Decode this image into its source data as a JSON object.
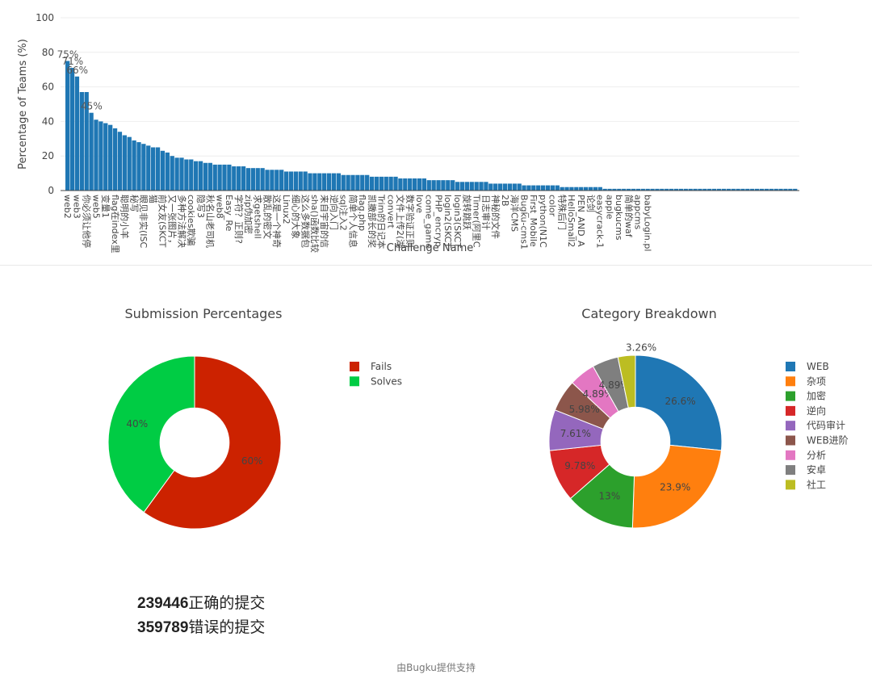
{
  "chart_data": [
    {
      "type": "bar",
      "title": "",
      "xlabel": "Challenge Name",
      "ylabel": "Percentage of Teams (%)",
      "ylim": [
        0,
        100
      ],
      "yticks": [
        0,
        20,
        40,
        60,
        80,
        100
      ],
      "grid": true,
      "bar_color": "#1f77b4",
      "categories": [
        "web2",
        "",
        "web3",
        "",
        "你必须让他停",
        "",
        "web5",
        "",
        "变量1",
        "",
        "flag在index里",
        "",
        "聪明的小羊",
        "",
        "秘写",
        "",
        "眼见非实(ISC",
        "",
        "猫",
        "",
        "前女友(SKCT",
        "",
        "又一张图片，",
        "",
        "多种方法解决",
        "",
        "cookies欺骗",
        "",
        "隐写3",
        "",
        "秋名山老司机",
        "",
        "web8",
        "",
        "Easy_Re",
        "",
        "字符？正则?",
        "",
        "zip伪加密",
        "",
        "求getshell",
        "",
        "散乱的密文",
        "",
        "这是一个神奇",
        "",
        "Linux2",
        "",
        "细心的大象",
        "",
        "这么多数据包",
        "",
        "sha()函数比较",
        "",
        "来自宇宙的信",
        "",
        "逆向入门",
        "",
        "sql注入2",
        "",
        "简单个人信息",
        "",
        "flag.php",
        "",
        "凯撒部长的奖",
        "",
        "Trim的日记本",
        "",
        "convert",
        "",
        "文件上传2(湖",
        "",
        "数字验证正则",
        "",
        "love",
        "",
        "come_game",
        "",
        "PHP_encryp",
        "",
        "login2(SKCT",
        "",
        "login3(SKCT",
        "",
        "旋转跳跃",
        "",
        "Timer(阿里C",
        "",
        "日志审计",
        "",
        "神秘的文件",
        "",
        "2B",
        "",
        "海洋CMS",
        "",
        "Bugku-cms1",
        "",
        "First_Mobile",
        "",
        "python(N1C",
        "",
        "color",
        "",
        "特殊后门",
        "",
        "HelloSmall2",
        "",
        "PEN_AND_A",
        "",
        "论剑",
        "",
        "easycrack-1",
        "",
        "apple",
        "",
        "bugkucms",
        "",
        "简单的waf",
        "",
        "appcms",
        "",
        "babyLogin.pl"
      ],
      "values": [
        75,
        71,
        66,
        57,
        57,
        45,
        41,
        40,
        39,
        38,
        36,
        34,
        32,
        31,
        29,
        28,
        27,
        26,
        25,
        25,
        23,
        22,
        20,
        19,
        19,
        18,
        18,
        17,
        17,
        16,
        16,
        15,
        15,
        15,
        15,
        14,
        14,
        14,
        13,
        13,
        13,
        13,
        12,
        12,
        12,
        12,
        11,
        11,
        11,
        11,
        11,
        10,
        10,
        10,
        10,
        10,
        10,
        10,
        9,
        9,
        9,
        9,
        9,
        9,
        8,
        8,
        8,
        8,
        8,
        8,
        7,
        7,
        7,
        7,
        7,
        7,
        6,
        6,
        6,
        6,
        6,
        6,
        5,
        5,
        5,
        5,
        5,
        5,
        5,
        4,
        4,
        4,
        4,
        4,
        4,
        4,
        3,
        3,
        3,
        3,
        3,
        3,
        3,
        3,
        2,
        2,
        2,
        2,
        2,
        2,
        2,
        2,
        2,
        1,
        1,
        1,
        1,
        1,
        1,
        1,
        1,
        1,
        1,
        1,
        1,
        1,
        1,
        1,
        1,
        1,
        1,
        1,
        1,
        1,
        1,
        1,
        1,
        1,
        1,
        1,
        1,
        1,
        1,
        1,
        1,
        1,
        1,
        1,
        1,
        1,
        1,
        1,
        1,
        1
      ],
      "data_labels": [
        {
          "index": 0,
          "text": "75%"
        },
        {
          "index": 1,
          "text": "71%"
        },
        {
          "index": 2,
          "text": "66%"
        },
        {
          "index": 5,
          "text": "45%"
        }
      ]
    },
    {
      "type": "pie",
      "title": "Submission Percentages",
      "hole": 0.4,
      "labels": [
        "Fails",
        "Solves"
      ],
      "values": [
        60,
        40
      ],
      "text_labels": [
        "60%",
        "40%"
      ],
      "colors": [
        "#cc2200",
        "#00cc44"
      ],
      "legend": "right"
    },
    {
      "type": "pie",
      "title": "Category Breakdown",
      "hole": 0.4,
      "labels": [
        "WEB",
        "杂项",
        "加密",
        "逆向",
        "代码审计",
        "WEB进阶",
        "分析",
        "安卓",
        "社工"
      ],
      "values": [
        26.6,
        23.9,
        13,
        9.78,
        7.61,
        5.98,
        4.89,
        4.89,
        3.26
      ],
      "text_labels": [
        "26.6%",
        "23.9%",
        "13%",
        "9.78%",
        "7.61%",
        "5.98%",
        "4.89%",
        "4.89%",
        "3.26%"
      ],
      "colors": [
        "#1f77b4",
        "#ff7f0e",
        "#2ca02c",
        "#d62728",
        "#9467bd",
        "#8c564b",
        "#e377c2",
        "#7f7f7f",
        "#bcbd22"
      ],
      "legend": "right"
    }
  ],
  "stats": {
    "correct_count": "239446",
    "correct_label": "正确的提交",
    "wrong_count": "359789",
    "wrong_label": "错误的提交"
  },
  "footer": "由Bugku提供支持"
}
